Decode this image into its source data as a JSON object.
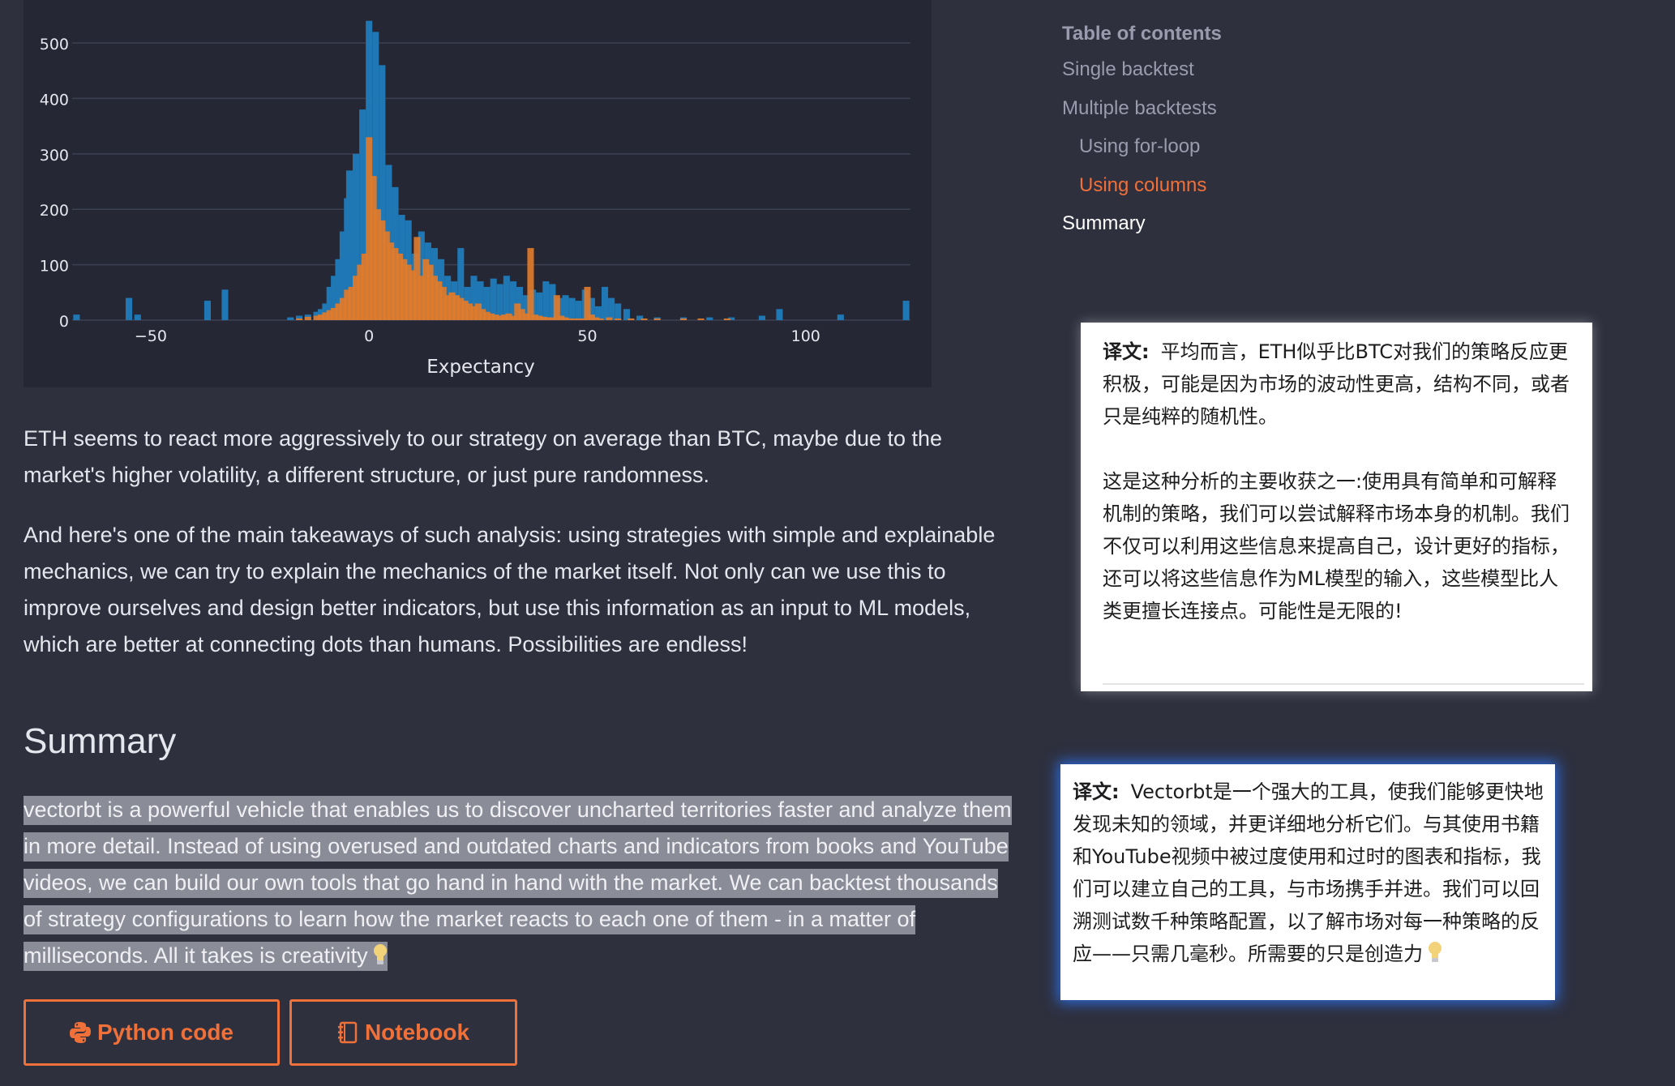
{
  "toc": {
    "title": "Table of contents",
    "items": [
      {
        "label": "Single backtest",
        "indent": false,
        "state": "normal"
      },
      {
        "label": "Multiple backtests",
        "indent": false,
        "state": "normal"
      },
      {
        "label": "Using for-loop",
        "indent": true,
        "state": "normal"
      },
      {
        "label": "Using columns",
        "indent": true,
        "state": "active"
      },
      {
        "label": "Summary",
        "indent": false,
        "state": "current"
      }
    ]
  },
  "content": {
    "para1": "ETH seems to react more aggressively to our strategy on average than BTC, maybe due to the market's higher volatility, a different structure, or just pure randomness.",
    "para2": "And here's one of the main takeaways of such analysis: using strategies with simple and explainable mechanics, we can try to explain the mechanics of the market itself. Not only can we use this to improve ourselves and design better indicators, but use this information as an input to ML models, which are better at connecting dots than humans. Possibilities are endless!",
    "summary_heading": "Summary",
    "summary_text": "vectorbt is a powerful vehicle that enables us to discover uncharted territories faster and analyze them in more detail. Instead of using overused and outdated charts and indicators from books and YouTube videos, we can build our own tools that go hand in hand with the market. We can backtest thousands of strategy configurations to learn how the market reacts to each one of them - in a matter of milliseconds. All it takes is creativity"
  },
  "buttons": {
    "python": "Python code",
    "notebook": "Notebook",
    "accent": "#f0703a"
  },
  "popups": {
    "label": "译文:",
    "popup1_p1": "平均而言，ETH似乎比BTC对我们的策略反应更积极，可能是因为市场的波动性更高，结构不同，或者只是纯粹的随机性。",
    "popup1_p2": "这是这种分析的主要收获之一:使用具有简单和可解释机制的策略，我们可以尝试解释市场本身的机制。我们不仅可以利用这些信息来提高自己，设计更好的指标，还可以将这些信息作为ML模型的输入，这些模型比人类更擅长连接点。可能性是无限的!",
    "popup2_text": "Vectorbt是一个强大的工具，使我们能够更快地发现未知的领域，并更详细地分析它们。与其使用书籍和YouTube视频中被过度使用和过时的图表和指标，我们可以建立自己的工具，与市场携手并进。我们可以回溯测试数千种策略配置，以了解市场对每一种策略的反应——只需几毫秒。所需要的只是创造力"
  },
  "chart_data": {
    "type": "bar",
    "xlabel": "Expectancy",
    "ylabel": "",
    "xlim": [
      -68,
      124
    ],
    "ylim": [
      0,
      560
    ],
    "xticks": [
      -50,
      0,
      50,
      100
    ],
    "yticks": [
      0,
      100,
      200,
      300,
      400,
      500
    ],
    "grid": true,
    "bin_width": 1.5,
    "series": [
      {
        "color": "#1f77b4",
        "x": [
          -67,
          -55,
          -53,
          -37,
          -33,
          -18,
          -16,
          -14,
          -12,
          -11,
          -10,
          -9,
          -8,
          -7,
          -6,
          -5,
          -4.5,
          -3,
          -1.5,
          0,
          1.5,
          3,
          4.5,
          6,
          7.5,
          9,
          10.5,
          12,
          13.5,
          15,
          16.5,
          18,
          19.5,
          21,
          22.5,
          24,
          25.5,
          27,
          28.5,
          30,
          31.5,
          33,
          34.5,
          36,
          37.5,
          39,
          40.5,
          42,
          43.5,
          45,
          46.5,
          48,
          49.5,
          51,
          52.5,
          54,
          55.5,
          57,
          59,
          62,
          66,
          72,
          78,
          83,
          90,
          94,
          108,
          123
        ],
        "values": [
          10,
          40,
          10,
          35,
          55,
          5,
          8,
          10,
          15,
          20,
          30,
          60,
          80,
          110,
          160,
          220,
          270,
          300,
          380,
          540,
          520,
          460,
          280,
          240,
          190,
          180,
          120,
          160,
          140,
          130,
          110,
          80,
          70,
          130,
          60,
          80,
          70,
          60,
          75,
          65,
          80,
          70,
          60,
          45,
          55,
          50,
          70,
          65,
          40,
          45,
          40,
          35,
          55,
          40,
          25,
          60,
          40,
          30,
          20,
          8,
          5,
          5,
          5,
          5,
          8,
          20,
          10,
          35
        ]
      },
      {
        "color": "#e07b2a",
        "x": [
          -16,
          -14,
          -12,
          -11,
          -10,
          -9,
          -8,
          -7,
          -6,
          -5,
          -4,
          -3,
          -2,
          -1,
          0,
          1,
          2,
          3,
          4,
          5,
          6,
          7,
          8,
          9,
          10,
          11,
          12,
          13,
          14,
          15,
          16,
          17,
          18,
          19,
          20,
          21,
          22,
          23,
          24,
          25,
          26,
          27,
          28,
          29,
          30,
          31,
          32,
          33,
          34,
          35,
          36,
          37,
          38,
          39,
          40,
          41,
          42,
          43,
          44,
          45,
          46,
          47,
          48,
          49,
          50,
          51,
          52,
          53,
          55,
          57,
          60,
          63,
          66,
          72,
          76,
          82
        ],
        "values": [
          3,
          6,
          8,
          10,
          14,
          18,
          22,
          30,
          40,
          55,
          60,
          80,
          100,
          120,
          330,
          260,
          200,
          180,
          160,
          140,
          130,
          120,
          110,
          100,
          90,
          150,
          80,
          110,
          100,
          80,
          70,
          60,
          45,
          50,
          45,
          40,
          35,
          30,
          25,
          30,
          20,
          15,
          12,
          10,
          8,
          10,
          12,
          8,
          30,
          20,
          12,
          130,
          10,
          8,
          6,
          5,
          5,
          45,
          8,
          5,
          3,
          3,
          3,
          3,
          60,
          10,
          5,
          3,
          5,
          3,
          3,
          3,
          3,
          3,
          3,
          3
        ]
      }
    ]
  }
}
